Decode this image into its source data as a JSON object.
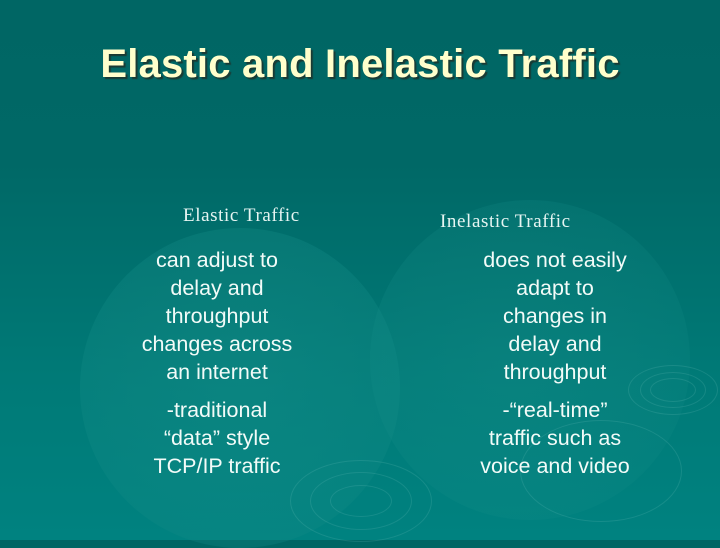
{
  "slide": {
    "title": "Elastic and Inelastic Traffic",
    "colors": {
      "background": "#006866",
      "title": "#ffffcc",
      "body_text": "#f2fbf8"
    },
    "columns": [
      {
        "heading": "Elastic Traffic",
        "paragraphs": [
          {
            "lines": [
              "can adjust to",
              "delay and",
              "throughput",
              "changes across",
              "an internet"
            ]
          },
          {
            "lines": [
              "-traditional",
              "“data” style",
              "TCP/IP traffic"
            ]
          }
        ]
      },
      {
        "heading": "Inelastic Traffic",
        "paragraphs": [
          {
            "lines": [
              "does not easily",
              "adapt to",
              "changes in",
              "delay and",
              "throughput"
            ]
          },
          {
            "lines": [
              "-“real-time”",
              "traffic such as",
              "voice and video"
            ]
          }
        ]
      }
    ]
  }
}
